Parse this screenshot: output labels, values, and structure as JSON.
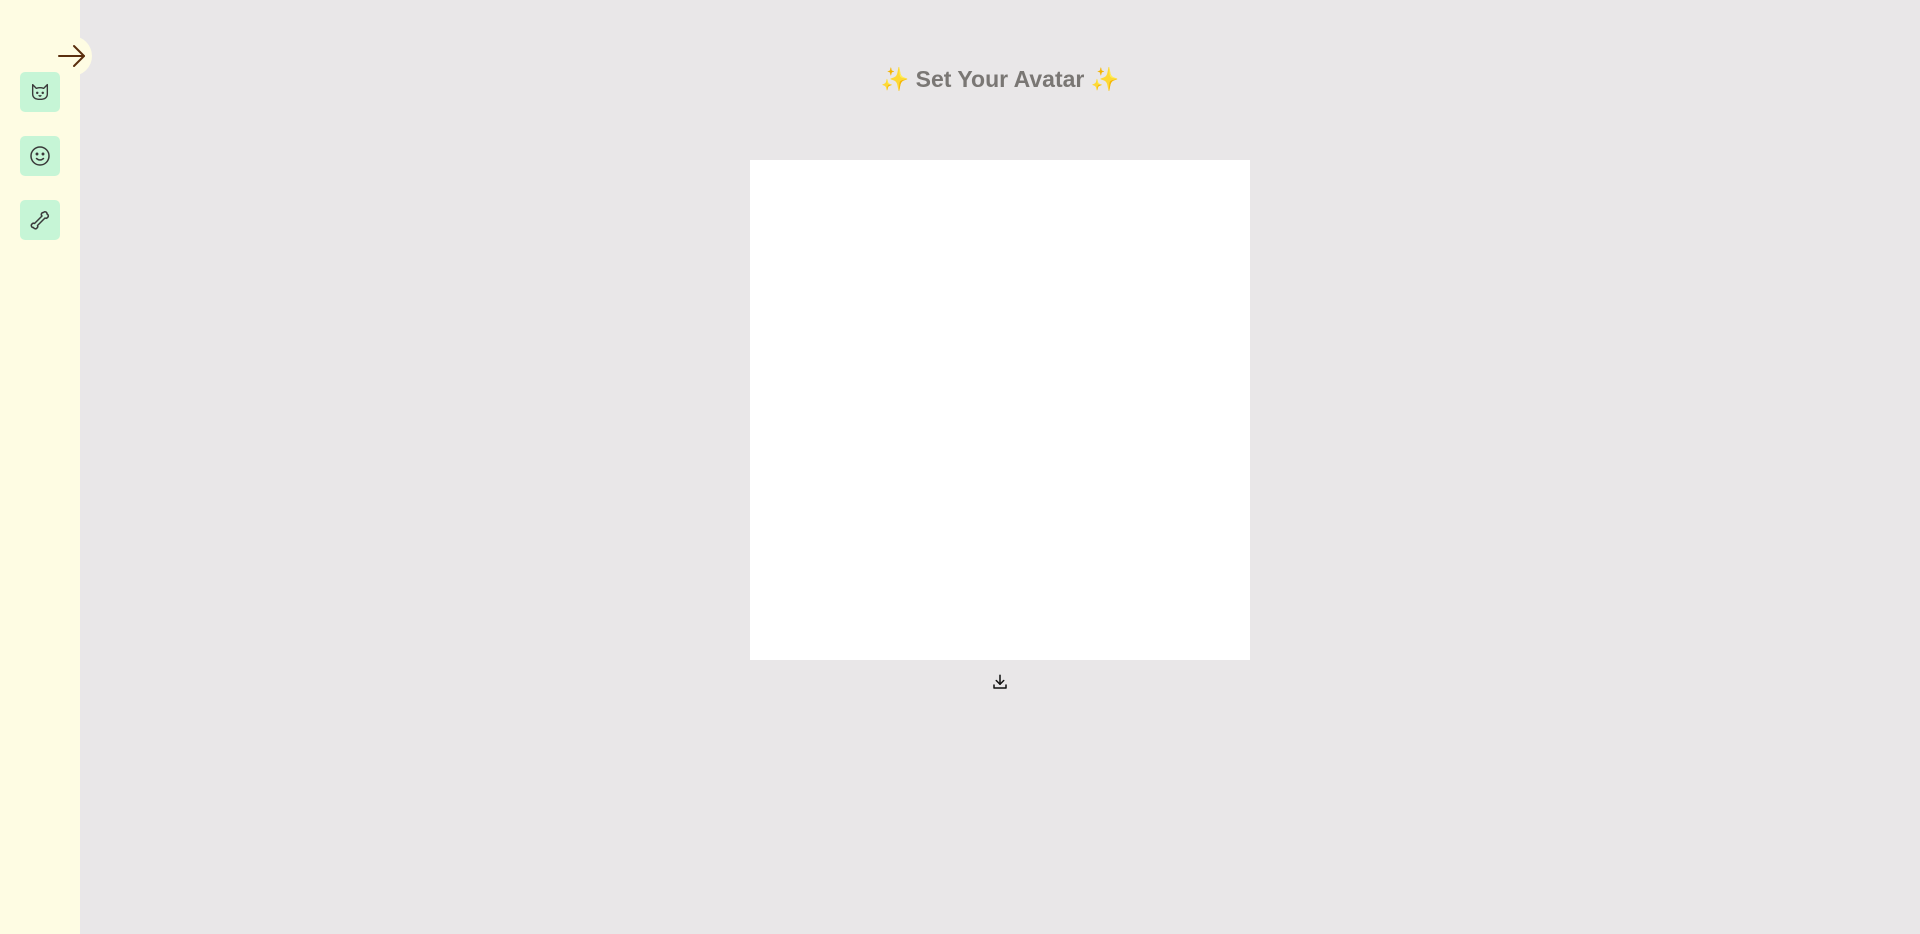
{
  "header": {
    "sparkle_left": "✨",
    "title": "Set Your Avatar",
    "sparkle_right": "✨"
  },
  "sidebar": {
    "toggle_icon": "arrow-right-icon",
    "tools": [
      {
        "icon": "cat-icon"
      },
      {
        "icon": "smiley-face-icon"
      },
      {
        "icon": "bone-icon"
      }
    ]
  },
  "canvas": {
    "download_icon": "download-icon"
  },
  "colors": {
    "page_background": "#e9e7e8",
    "sidebar_background": "#fefce3",
    "tool_button_background": "#c6f5d6",
    "title_text": "#7a7774",
    "canvas_background": "#ffffff"
  }
}
